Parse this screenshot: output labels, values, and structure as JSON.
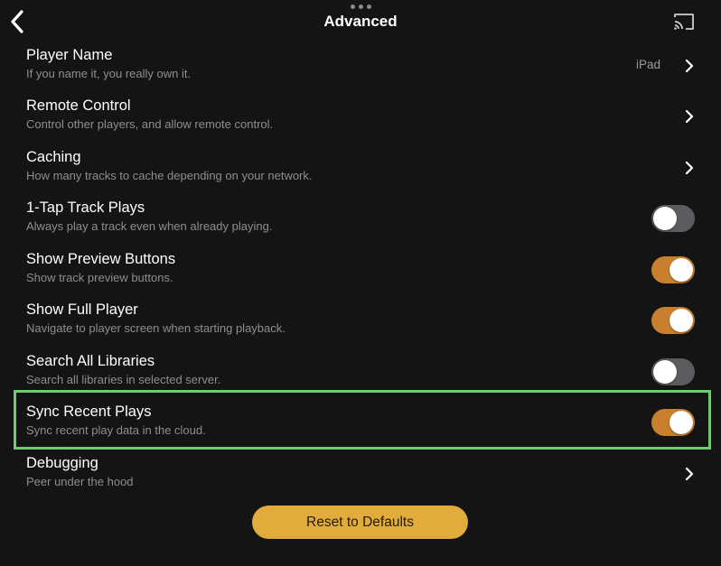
{
  "header": {
    "title": "Advanced",
    "back_icon": "chevron-left-icon",
    "cast_icon": "cast-icon",
    "more_icon": "more-dots-icon"
  },
  "accent_color": "#c8802e",
  "settings": [
    {
      "label": "Player Name",
      "description": "If you name it, you really own it.",
      "value": "iPad",
      "control": "chevron"
    },
    {
      "label": "Remote Control",
      "description": "Control other players, and allow remote control.",
      "control": "chevron"
    },
    {
      "label": "Caching",
      "description": "How many tracks to cache depending on your network.",
      "control": "chevron"
    },
    {
      "label": "1-Tap Track Plays",
      "description": "Always play a track even when already playing.",
      "control": "toggle",
      "on": false
    },
    {
      "label": "Show Preview Buttons",
      "description": "Show track preview buttons.",
      "control": "toggle",
      "on": true
    },
    {
      "label": "Show Full Player",
      "description": "Navigate to player screen when starting playback.",
      "control": "toggle",
      "on": true
    },
    {
      "label": "Search All Libraries",
      "description": "Search all libraries in selected server.",
      "control": "toggle",
      "on": false
    },
    {
      "label": "Sync Recent Plays",
      "description": "Sync recent play data in the cloud.",
      "control": "toggle",
      "on": true
    },
    {
      "label": "Debugging",
      "description": "Peer under the hood",
      "control": "chevron"
    }
  ],
  "reset_button": "Reset to Defaults"
}
